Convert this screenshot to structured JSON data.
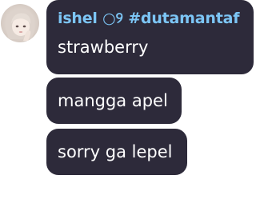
{
  "sender": {
    "name": "ishel ○୨ #dutamantaf"
  },
  "messages": [
    {
      "text": "strawberry"
    },
    {
      "text": "mangga apel"
    },
    {
      "text": "sorry ga lepel"
    }
  ],
  "colors": {
    "bubble": "#2d2a3a",
    "sender_name": "#7cc5f5",
    "message_text": "#ffffff"
  }
}
